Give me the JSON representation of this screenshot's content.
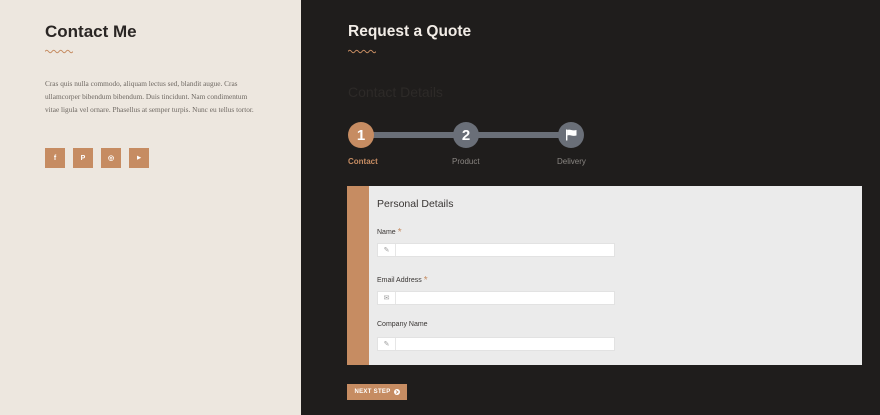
{
  "contact": {
    "title": "Contact Me",
    "body": "Cras quis nulla commodo, aliquam lectus sed, blandit augue. Cras ullamcorper bibendum bibendum. Duis tincidunt. Nam condimentum vitae ligula vel ornare. Phasellus at semper turpis. Nunc eu tellus tortor.",
    "socials": [
      {
        "icon": "facebook-icon",
        "glyph": "f"
      },
      {
        "icon": "pinterest-icon",
        "glyph": "P"
      },
      {
        "icon": "instagram-icon",
        "glyph": "◎"
      },
      {
        "icon": "youtube-icon",
        "glyph": "▶"
      }
    ]
  },
  "quote": {
    "title": "Request a Quote",
    "section_title": "Contact Details",
    "steps": [
      {
        "number": "1",
        "label": "Contact",
        "active": true
      },
      {
        "number": "2",
        "label": "Product",
        "active": false
      },
      {
        "number": "",
        "label": "Delivery",
        "active": false,
        "icon": "flag-icon"
      }
    ]
  },
  "form": {
    "heading": "Personal Details",
    "fields": [
      {
        "label": "Name",
        "required": true,
        "icon": "pencil-icon",
        "value": "",
        "placeholder": ""
      },
      {
        "label": "Email Address",
        "required": true,
        "icon": "envelope-icon",
        "value": "",
        "placeholder": ""
      },
      {
        "label": "Company Name",
        "required": false,
        "icon": "pencil-icon",
        "value": "",
        "placeholder": ""
      }
    ],
    "required_marker": "*"
  },
  "next_button": {
    "label": "NEXT STEP"
  },
  "colors": {
    "accent": "#c68c62",
    "left_bg": "#ede7df",
    "right_bg": "#1f1d1c",
    "step_inactive": "#6a6f78",
    "card_bg": "#ebebeb"
  }
}
